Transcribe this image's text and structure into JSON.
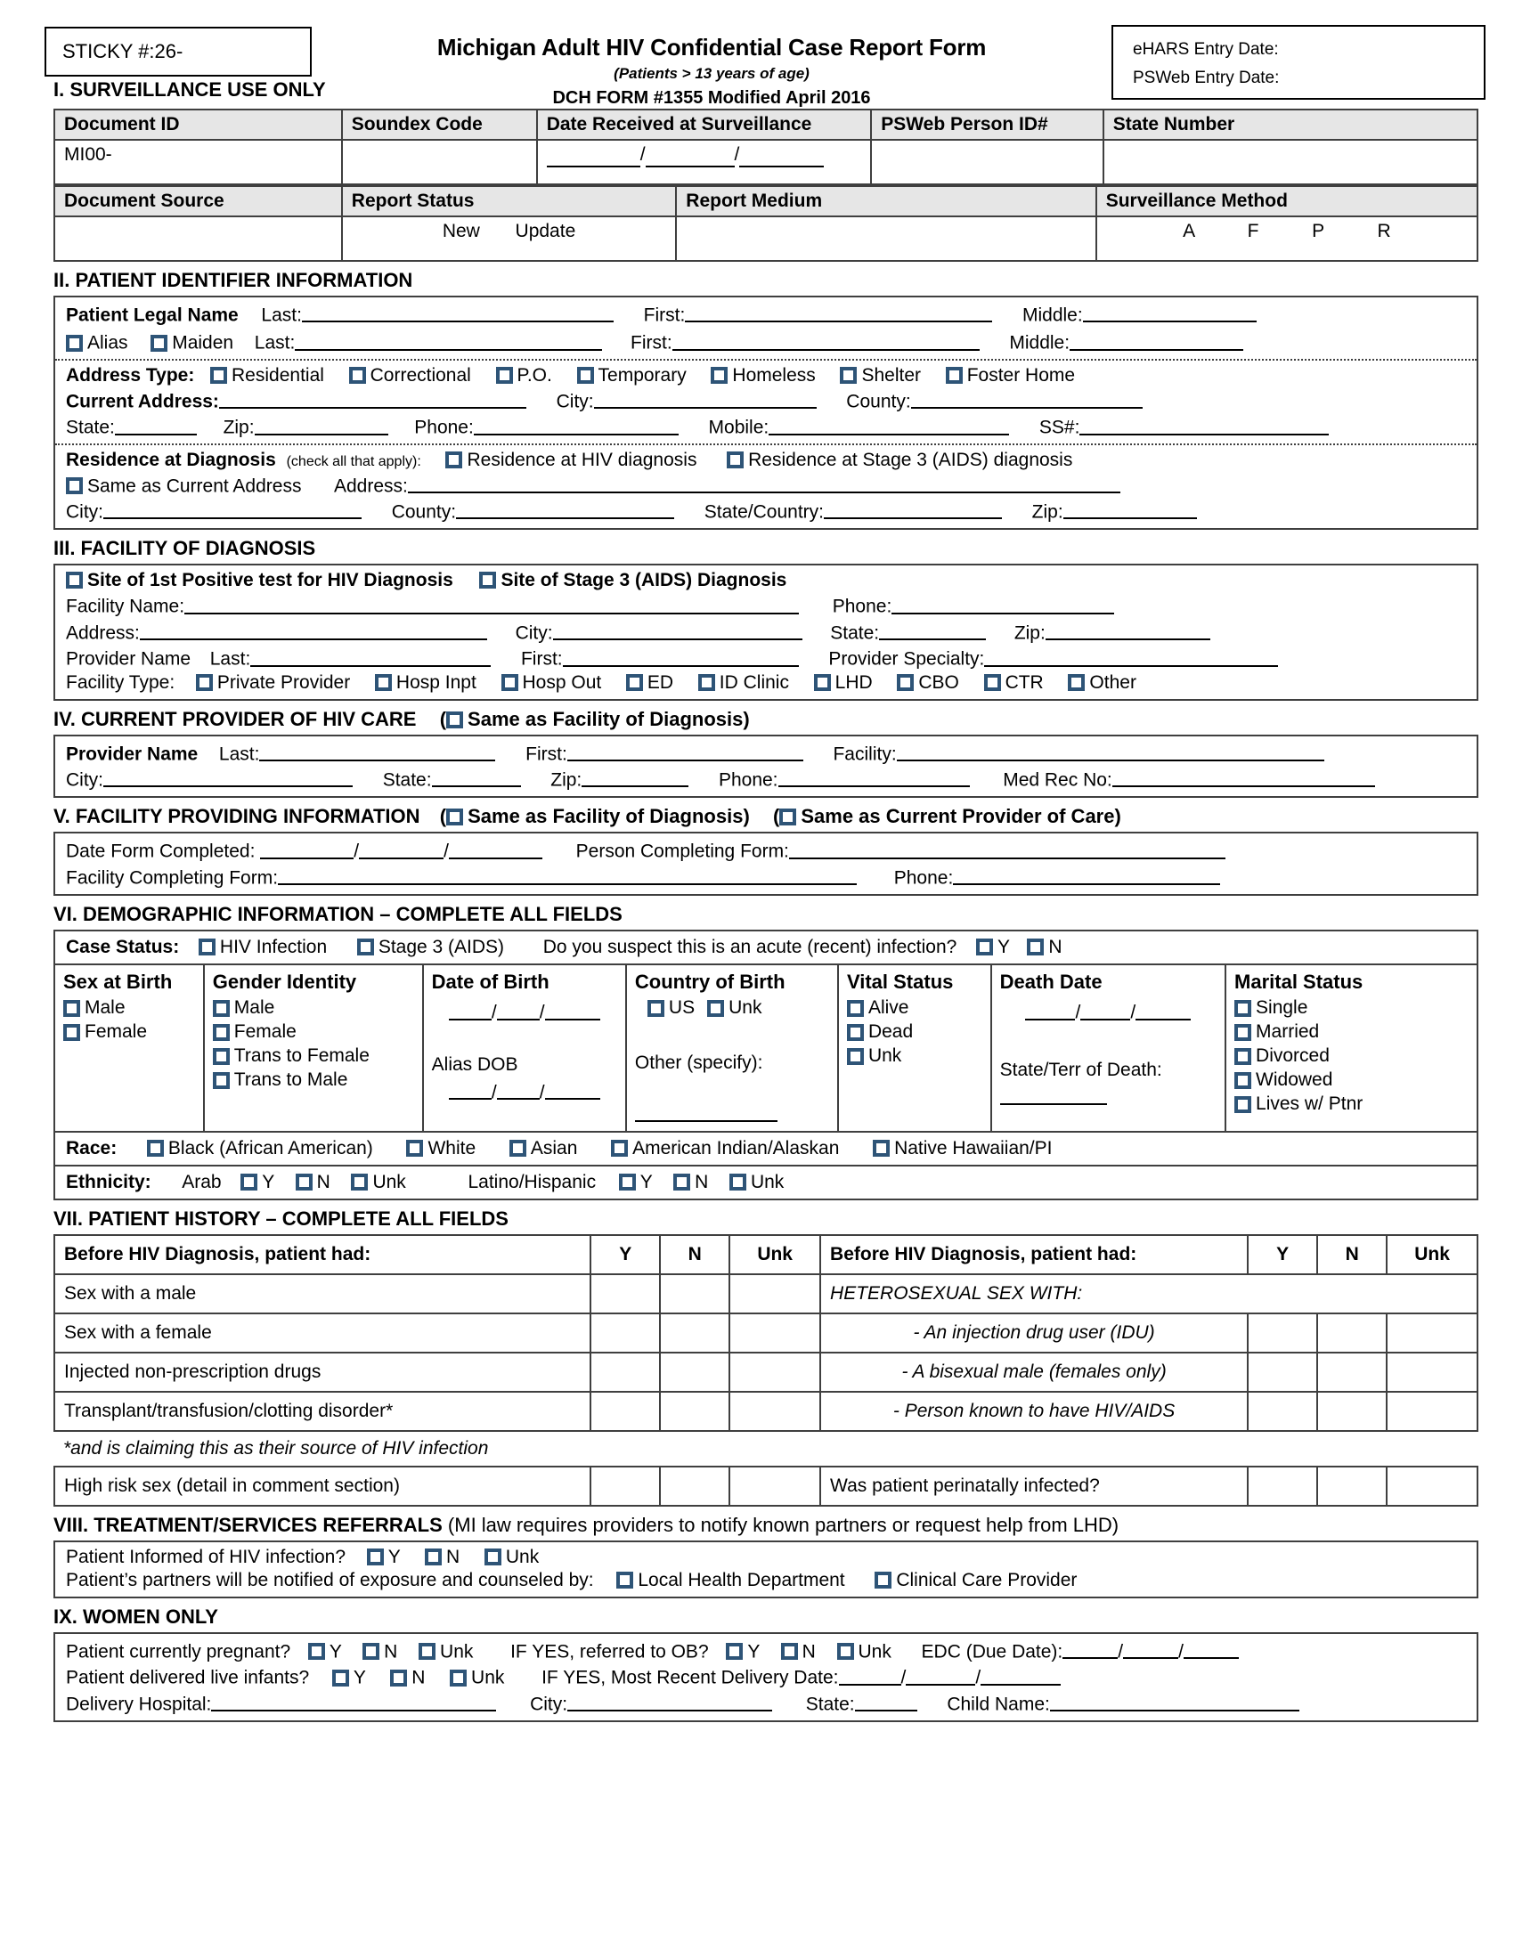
{
  "header": {
    "sticky_label": "STICKY #:26-",
    "title": "Michigan Adult HIV Confidential Case Report Form",
    "subtitle": "(Patients > 13 years of age)",
    "form_number": "DCH FORM #1355 Modified April 2016",
    "ehars_entry_date": "eHARS Entry Date:",
    "psweb_entry_date": "PSWeb Entry Date:"
  },
  "section1": {
    "heading": "I.  SURVEILLANCE USE ONLY",
    "row1_headers": [
      "Document ID",
      "Soundex Code",
      "Date Received at Surveillance",
      "PSWeb Person ID#",
      "State Number"
    ],
    "document_id_prefix": "MI00-",
    "row2_headers": [
      "Document Source",
      "Report Status",
      "Report Medium",
      "Surveillance Method"
    ],
    "report_status_options": [
      "New",
      "Update"
    ],
    "surveillance_method_options": [
      "A",
      "F",
      "P",
      "R"
    ]
  },
  "section2": {
    "heading": "II.  PATIENT IDENTIFIER INFORMATION",
    "legal_name_label": "Patient Legal Name",
    "last_label": "Last:",
    "first_label": "First:",
    "middle_label": "Middle:",
    "alias_label": "Alias",
    "maiden_label": "Maiden",
    "address_type_label": "Address Type:",
    "address_types": [
      "Residential",
      "Correctional",
      "P.O.",
      "Temporary",
      "Homeless",
      "Shelter",
      "Foster Home"
    ],
    "current_address_label": "Current Address:",
    "city_label": "City:",
    "county_label": "County:",
    "state_label": "State:",
    "zip_label": "Zip:",
    "phone_label": "Phone:",
    "mobile_label": "Mobile:",
    "ss_label": "SS#:",
    "residence_label": "Residence at Diagnosis",
    "residence_note": "(check all that apply):",
    "residence_hiv": "Residence at HIV diagnosis",
    "residence_stage3": "Residence at Stage 3 (AIDS) diagnosis",
    "same_as_current": "Same as Current Address",
    "address_label": "Address:",
    "state_country_label": "State/Country:"
  },
  "section3": {
    "heading": "III.  FACILITY OF DIAGNOSIS",
    "site_first_positive": "Site of 1st Positive test for HIV Diagnosis",
    "site_stage3": "Site of Stage 3 (AIDS) Diagnosis",
    "facility_name_label": "Facility Name:",
    "phone_label": "Phone:",
    "address_label": "Address:",
    "city_label": "City:",
    "state_label": "State:",
    "zip_label": "Zip:",
    "provider_name_label": "Provider Name",
    "last_label": "Last:",
    "first_label": "First:",
    "provider_specialty_label": "Provider Specialty:",
    "facility_type_label": "Facility Type:",
    "facility_types": [
      "Private Provider",
      "Hosp Inpt",
      "Hosp Out",
      "ED",
      "ID Clinic",
      "LHD",
      "CBO",
      "CTR",
      "Other"
    ]
  },
  "section4": {
    "heading": "IV.  CURRENT PROVIDER OF HIV CARE",
    "same_as_facility": "Same as Facility of Diagnosis",
    "provider_name_label": "Provider Name",
    "last_label": "Last:",
    "first_label": "First:",
    "facility_label": "Facility:",
    "city_label": "City:",
    "state_label": "State:",
    "zip_label": "Zip:",
    "phone_label": "Phone:",
    "med_rec_label": "Med Rec No:"
  },
  "section5": {
    "heading": "V.  FACILITY PROVIDING INFORMATION",
    "same_as_facility": "Same as Facility of Diagnosis",
    "same_as_provider": "Same as Current Provider of Care",
    "date_form_completed_label": "Date Form Completed:",
    "person_completing_label": "Person Completing Form:",
    "facility_completing_label": "Facility Completing Form:",
    "phone_label": "Phone:"
  },
  "section6": {
    "heading": "VI.  DEMOGRAPHIC INFORMATION – COMPLETE ALL FIELDS",
    "case_status_label": "Case Status:",
    "case_status_options": [
      "HIV Infection",
      "Stage 3 (AIDS)"
    ],
    "acute_question": "Do you suspect this is an acute (recent) infection?",
    "yes_label": "Y",
    "no_label": "N",
    "columns": {
      "sex_at_birth": {
        "title": "Sex at Birth",
        "options": [
          "Male",
          "Female"
        ]
      },
      "gender_identity": {
        "title": "Gender Identity",
        "options": [
          "Male",
          "Female",
          "Trans to Female",
          "Trans to Male"
        ]
      },
      "date_of_birth": {
        "title": "Date of Birth",
        "alias_dob_label": "Alias DOB"
      },
      "country_of_birth": {
        "title": "Country of Birth",
        "options": [
          "US",
          "Unk"
        ],
        "other_label": "Other (specify):"
      },
      "vital_status": {
        "title": "Vital Status",
        "options": [
          "Alive",
          "Dead",
          "Unk"
        ]
      },
      "death_date": {
        "title": "Death Date",
        "state_terr_label": "State/Terr of Death:"
      },
      "marital_status": {
        "title": "Marital Status",
        "options": [
          "Single",
          "Married",
          "Divorced",
          "Widowed",
          "Lives w/ Ptnr"
        ]
      }
    },
    "race_label": "Race:",
    "race_options": [
      "Black (African American)",
      "White",
      "Asian",
      "American Indian/Alaskan",
      "Native Hawaiian/PI"
    ],
    "ethnicity_label": "Ethnicity:",
    "ethnicity_arab_label": "Arab",
    "ethnicity_latino_label": "Latino/Hispanic",
    "ethnicity_options": [
      "Y",
      "N",
      "Unk"
    ]
  },
  "section7": {
    "heading": "VII.  PATIENT HISTORY – COMPLETE ALL FIELDS",
    "col_header_left": "Before HIV Diagnosis, patient had:",
    "col_header_right": "Before HIV Diagnosis, patient had:",
    "yn_headers": [
      "Y",
      "N",
      "Unk"
    ],
    "left_rows": [
      "Sex with a male",
      "Sex with a female",
      "Injected non-prescription drugs",
      "Transplant/transfusion/clotting disorder*"
    ],
    "right_rows": [
      "HETEROSEXUAL SEX WITH:",
      "-  An injection drug user (IDU)",
      "-  A bisexual male (females only)",
      "-  Person known to have HIV/AIDS"
    ],
    "footnote": "*and is claiming this as their source of HIV infection",
    "bottom_left": "High risk sex (detail in comment section)",
    "bottom_right": "Was patient perinatally infected?"
  },
  "section8": {
    "heading": "VIII.  TREATMENT/SERVICES REFERRALS",
    "heading_note": "(MI law requires providers to notify known partners or request help from LHD)",
    "informed_question": "Patient Informed of HIV infection?",
    "informed_options": [
      "Y",
      "N",
      "Unk"
    ],
    "partners_text": "Patient’s partners will be notified of exposure and counseled by:",
    "partner_options": [
      "Local Health Department",
      "Clinical Care Provider"
    ]
  },
  "section9": {
    "heading": "IX.  WOMEN ONLY",
    "pregnant_question": "Patient currently pregnant?",
    "pregnant_options": [
      "Y",
      "N",
      "Unk"
    ],
    "referred_ob_question": "IF YES, referred to OB?",
    "referred_ob_options": [
      "Y",
      "N",
      "Unk"
    ],
    "edc_label": "EDC (Due Date):",
    "delivered_question": "Patient delivered live infants?",
    "delivered_options": [
      "Y",
      "N",
      "Unk"
    ],
    "most_recent_delivery_label": "IF YES,  Most Recent Delivery Date:",
    "delivery_hospital_label": "Delivery Hospital:",
    "city_label": "City:",
    "state_label": "State:",
    "child_name_label": "Child Name:"
  },
  "colors": {
    "checkbox_border": "#2e5477",
    "table_header_fill": "#e6e6e6",
    "rule": "#3f3f3f"
  }
}
